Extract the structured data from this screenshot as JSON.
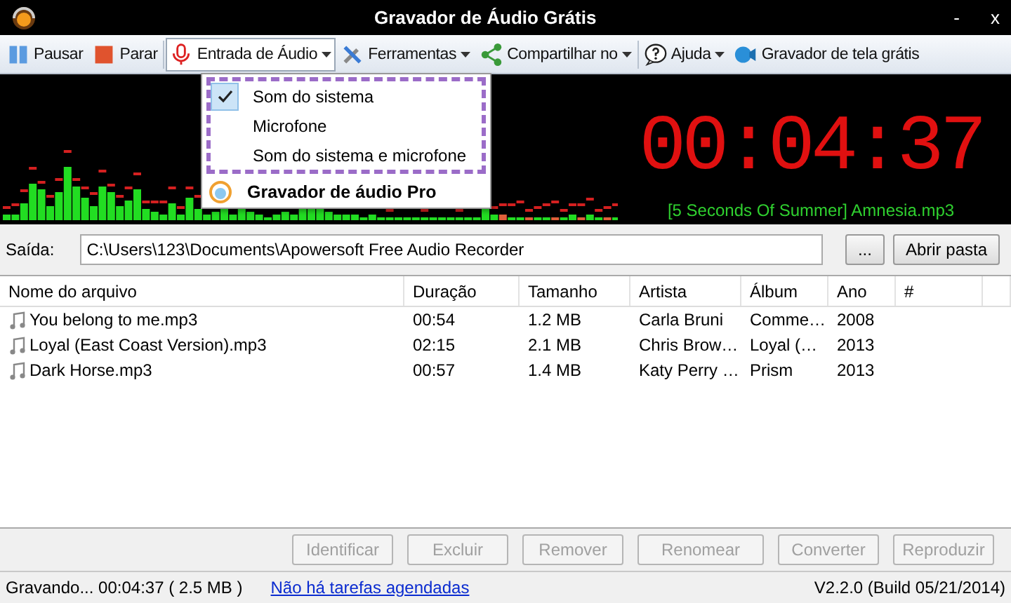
{
  "window": {
    "title": "Gravador de Áudio Grátis",
    "minimize": "-",
    "close": "x"
  },
  "toolbar": {
    "items": [
      {
        "label": "Pausar",
        "kind": "pause",
        "dropdown": false,
        "pressed": false
      },
      {
        "label": "Parar",
        "kind": "stop",
        "dropdown": false,
        "pressed": false
      },
      {
        "label": "Entrada de Áudio",
        "kind": "mic",
        "dropdown": true,
        "pressed": true
      },
      {
        "label": "Ferramentas",
        "kind": "tools",
        "dropdown": true,
        "pressed": false
      },
      {
        "label": "Compartilhar no",
        "kind": "share",
        "dropdown": true,
        "pressed": false
      },
      {
        "label": "Ajuda",
        "kind": "help",
        "dropdown": true,
        "pressed": false
      },
      {
        "label": "Gravador de tela grátis",
        "kind": "camera",
        "dropdown": false,
        "pressed": false
      }
    ]
  },
  "audio_menu": {
    "items": [
      {
        "label": "Som do sistema",
        "checked": true
      },
      {
        "label": "Microfone",
        "checked": false
      },
      {
        "label": "Som do sistema e microfone",
        "checked": false
      }
    ],
    "pro_item": "Gravador de áudio Pro"
  },
  "recorder": {
    "time": "00:04:37",
    "track": "[5 Seconds Of Summer] Amnesia.mp3"
  },
  "output": {
    "label": "Saída:",
    "path": "C:\\Users\\123\\Documents\\Apowersoft Free Audio Recorder",
    "browse": "...",
    "open": "Abrir pasta"
  },
  "table": {
    "columns": [
      "Nome do arquivo",
      "Duração",
      "Tamanho",
      "Artista",
      "Álbum",
      "Ano",
      "#"
    ],
    "rows": [
      [
        "You belong to me.mp3",
        "00:54",
        "1.2 MB",
        "Carla Bruni",
        "Comme…",
        "2008",
        ""
      ],
      [
        "Loyal (East Coast Version).mp3",
        "02:15",
        "2.1 MB",
        "Chris Brow…",
        "Loyal (…",
        "2013",
        ""
      ],
      [
        "Dark Horse.mp3",
        "00:57",
        "1.4 MB",
        "Katy Perry …",
        "Prism",
        "2013",
        ""
      ]
    ]
  },
  "actions": [
    {
      "label": "Identificar",
      "disabled": true
    },
    {
      "label": "Excluir",
      "disabled": true
    },
    {
      "label": "Remover",
      "disabled": true
    },
    {
      "label": "Renomear",
      "disabled": true
    },
    {
      "label": "Converter",
      "disabled": true
    },
    {
      "label": "Reproduzir",
      "disabled": true
    }
  ],
  "status_bar": {
    "recording": "Gravando... 00:04:37 ( 2.5 MB )",
    "link": "Não há tarefas agendadas",
    "version": "V2.2.0 (Build 05/21/2014)"
  }
}
